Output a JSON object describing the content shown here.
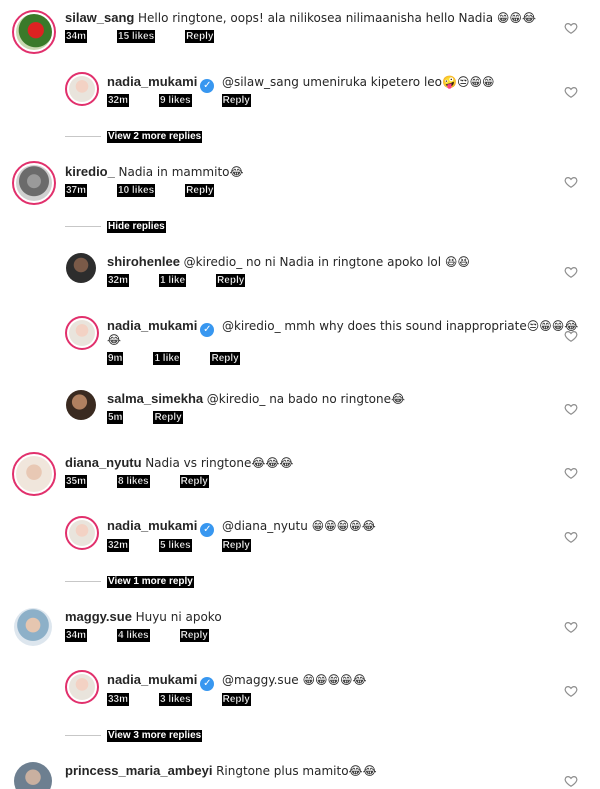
{
  "comments": [
    {
      "id": "c1",
      "username": "silaw_sang",
      "verified": false,
      "text": "Hello ringtone, oops! ala nilikosea nilimaanisha hello Nadia 😁😁😂",
      "time": "34m",
      "likes": "15 likes",
      "reply": "Reply"
    },
    {
      "id": "c2",
      "username": "nadia_mukami",
      "verified": true,
      "text": "@silaw_sang umeniruka kipetero leo🤪😒😁😁",
      "time": "32m",
      "likes": "9 likes",
      "reply": "Reply"
    },
    {
      "id": "c3",
      "username": "kiredio_",
      "verified": false,
      "text": "Nadia in mammito😂",
      "time": "37m",
      "likes": "10 likes",
      "reply": "Reply"
    },
    {
      "id": "c4",
      "username": "shirohenlee",
      "verified": false,
      "text": "@kiredio_ no ni Nadia in ringtone apoko lol 😆😆",
      "time": "32m",
      "likes": "1 like",
      "reply": "Reply"
    },
    {
      "id": "c5",
      "username": "nadia_mukami",
      "verified": true,
      "text": "@kiredio_ mmh why does this sound inappropriate😒😁😁😂",
      "text2": "😂",
      "time": "9m",
      "likes": "1 like",
      "reply": "Reply"
    },
    {
      "id": "c6",
      "username": "salma_simekha",
      "verified": false,
      "text": "@kiredio_ na bado no ringtone😂",
      "time": "5m",
      "likes": "",
      "reply": "Reply"
    },
    {
      "id": "c7",
      "username": "diana_nyutu",
      "verified": false,
      "text": "Nadia vs ringtone😂😂😂",
      "time": "35m",
      "likes": "8 likes",
      "reply": "Reply"
    },
    {
      "id": "c8",
      "username": "nadia_mukami",
      "verified": true,
      "text": "@diana_nyutu 😁😁😁😁😂",
      "time": "32m",
      "likes": "5 likes",
      "reply": "Reply"
    },
    {
      "id": "c9",
      "username": "maggy.sue",
      "verified": false,
      "text": "Huyu ni apoko",
      "time": "34m",
      "likes": "4 likes",
      "reply": "Reply"
    },
    {
      "id": "c10",
      "username": "nadia_mukami",
      "verified": true,
      "text": "@maggy.sue 😁😁😁😁😂",
      "time": "33m",
      "likes": "3 likes",
      "reply": "Reply"
    },
    {
      "id": "c11",
      "username": "princess_maria_ambeyi",
      "verified": false,
      "text": "Ringtone plus mamito😂😂",
      "time": "",
      "likes": "",
      "reply": ""
    }
  ],
  "thread_links": {
    "view_2": "View 2 more replies",
    "hide": "Hide replies",
    "view_1": "View 1 more reply",
    "view_3": "View 3 more replies"
  },
  "verified_glyph": "✓",
  "colors": {
    "ring": "#e1306c",
    "verified": "#3897f0",
    "text": "#262626"
  }
}
